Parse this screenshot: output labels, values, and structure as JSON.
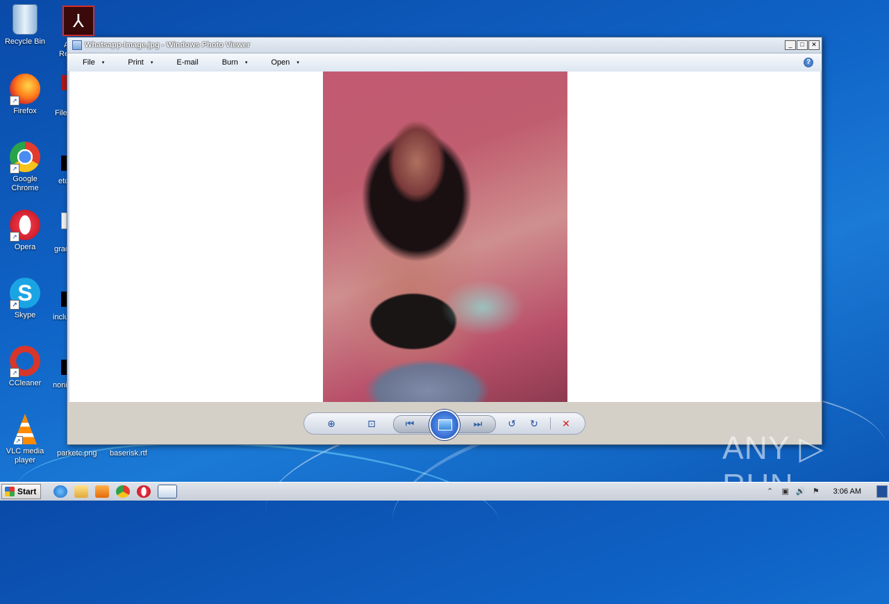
{
  "desktop": {
    "icons": [
      {
        "label": "Recycle Bin"
      },
      {
        "label": "Firefox"
      },
      {
        "label": "Google Chrome"
      },
      {
        "label": "Opera"
      },
      {
        "label": "Skype"
      },
      {
        "label": "CCleaner"
      },
      {
        "label": "VLC media player"
      }
    ],
    "partial_labels": [
      "A",
      "Re",
      "File",
      "etc",
      "grad",
      "inclu",
      "noni"
    ],
    "bottom_files": [
      "parketc.png",
      "baserisk.rtf"
    ]
  },
  "window": {
    "title": "Whatsapp-Image.jpg - Windows Photo Viewer",
    "title_buttons": [
      "_",
      "□",
      "✕"
    ],
    "menu": [
      "File",
      "Print",
      "E-mail",
      "Burn",
      "Open"
    ],
    "menu_caret": "▾",
    "help": "?",
    "controls": {
      "zoom": "⊕",
      "fit": "⊡",
      "prev": "⏮",
      "next": "⏭",
      "rotate_ccw": "↺",
      "rotate_cw": "↻",
      "delete": "✕"
    }
  },
  "watermark": "ANY ▷ RUN",
  "taskbar": {
    "start_label": "Start",
    "clock": "3:06 AM",
    "tray_icons": [
      "⌃",
      "▣",
      "🔊",
      "⚑"
    ]
  },
  "colors": {
    "desktop_blue": "#0f63c6",
    "taskbar": "#d4d8e0",
    "delete_red": "#d12020"
  }
}
